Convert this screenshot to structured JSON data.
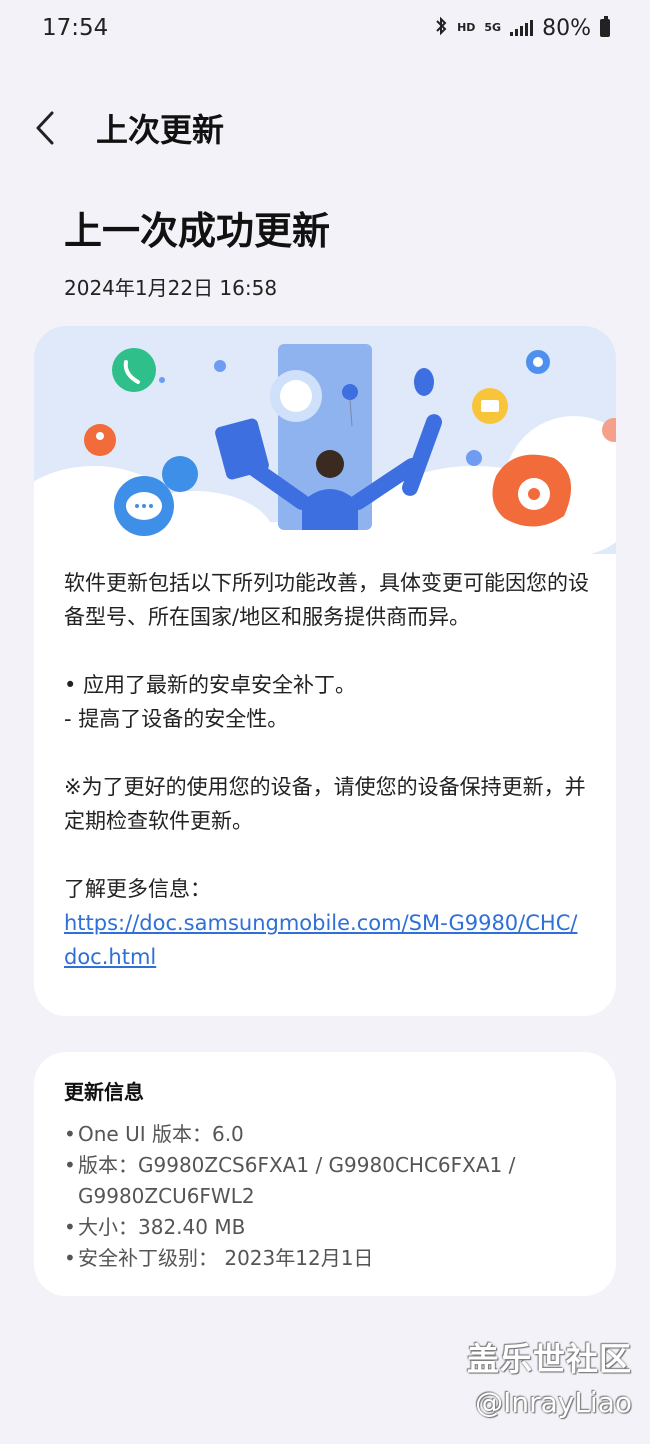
{
  "status_bar": {
    "time": "17:54",
    "hd": "HD",
    "network": "5G",
    "battery": "80%"
  },
  "header": {
    "title": "上次更新"
  },
  "main": {
    "title": "上一次成功更新",
    "date": "2024年1月22日 16:58"
  },
  "notes": {
    "paragraph1": "软件更新包括以下所列功能改善，具体变更可能因您的设备型号、所在国家/地区和服务提供商而异。",
    "bullet1": "• 应用了最新的安卓安全补丁。",
    "bullet1_sub": " - 提高了设备的安全性。",
    "paragraph2": "※为了更好的使用您的设备，请使您的设备保持更新，并定期检查软件更新。",
    "more_info_label": "了解更多信息：",
    "link": "https://doc.samsungmobile.com/SM-G9980/CHC/doc.html"
  },
  "update_info": {
    "title": "更新信息",
    "items": [
      "One UI 版本：6.0",
      "版本：G9980ZCS6FXA1 / G9980CHC6FXA1 / G9980ZCU6FWL2",
      "大小：382.40 MB",
      "安全补丁级别： 2023年12月1日"
    ]
  },
  "watermark": {
    "line1": "盖乐世社区",
    "line2": "@InrayLiao"
  },
  "colors": {
    "background": "#f3f2f8",
    "card": "#ffffff",
    "link": "#2e6fd8",
    "illustration_blue": "#3d6fe0",
    "illustration_orange": "#f26b3a",
    "illustration_green": "#2fbf8a"
  },
  "icons": [
    "bluetooth-icon",
    "signal-icon",
    "battery-icon",
    "back-arrow-icon"
  ]
}
